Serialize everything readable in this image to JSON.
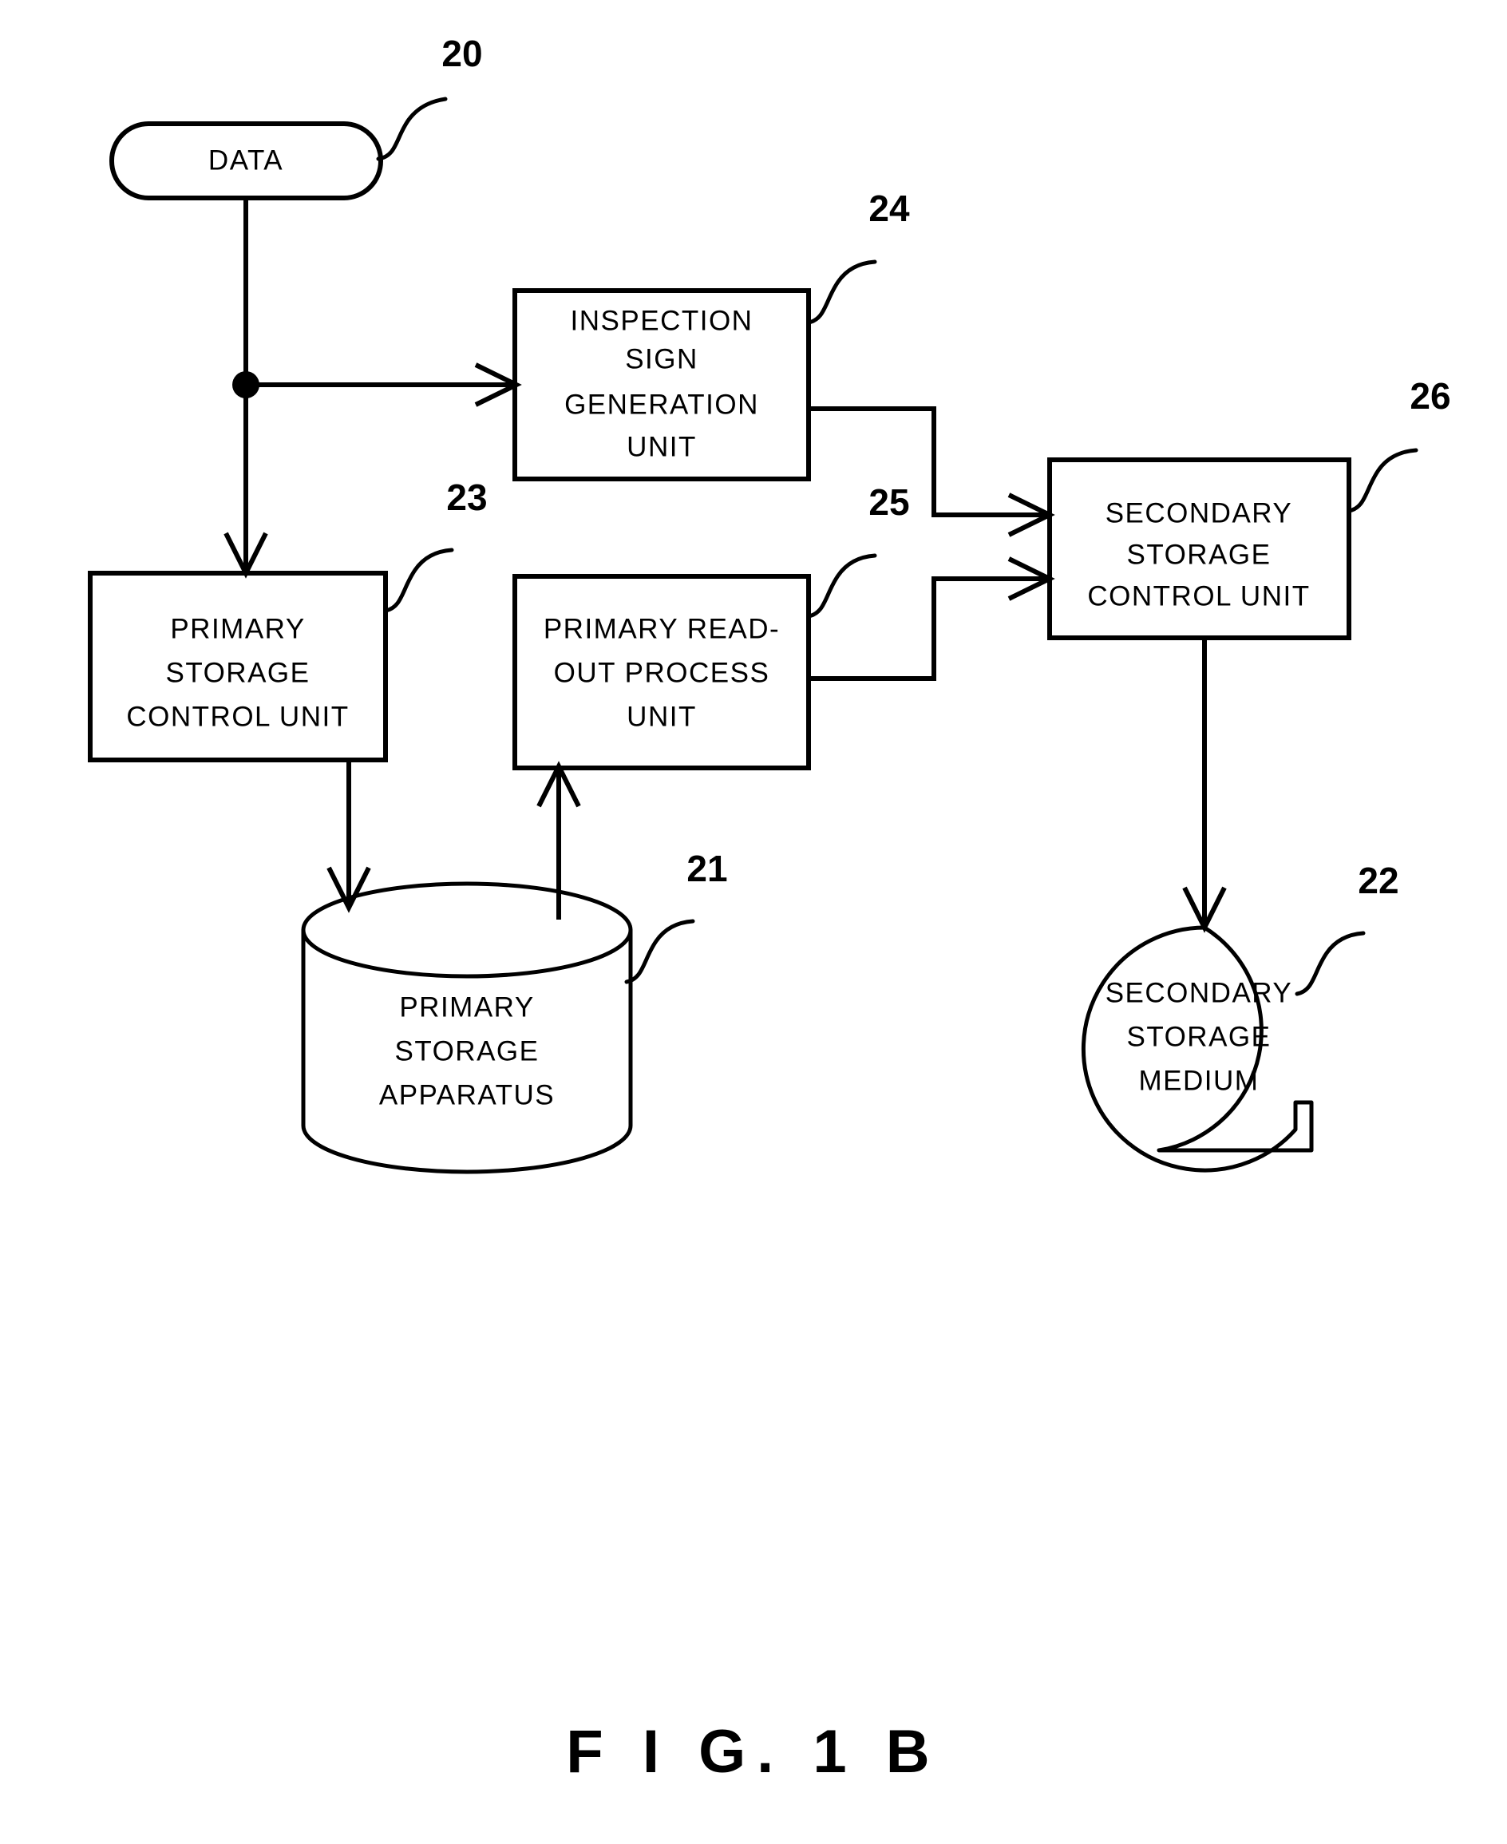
{
  "figure": {
    "caption": "F I G.  1 B",
    "background_color": "#ffffff",
    "line_color": "#000000"
  },
  "nodes": [
    {
      "id": "data",
      "shape": "rounded-pill",
      "ref": "20",
      "lines": [
        "DATA"
      ]
    },
    {
      "id": "inspection-sign-generation-unit",
      "shape": "rectangle",
      "ref": "24",
      "lines": [
        "INSPECTION",
        "SIGN",
        "GENERATION",
        "UNIT"
      ]
    },
    {
      "id": "primary-storage-control-unit",
      "shape": "rectangle",
      "ref": "23",
      "lines": [
        "PRIMARY",
        "STORAGE",
        "CONTROL UNIT"
      ]
    },
    {
      "id": "primary-read-out-process-unit",
      "shape": "rectangle",
      "ref": "25",
      "lines": [
        "PRIMARY READ-",
        "OUT PROCESS",
        "UNIT"
      ]
    },
    {
      "id": "secondary-storage-control-unit",
      "shape": "rectangle",
      "ref": "26",
      "lines": [
        "SECONDARY",
        "STORAGE",
        "CONTROL UNIT"
      ]
    },
    {
      "id": "primary-storage-apparatus",
      "shape": "cylinder",
      "ref": "21",
      "lines": [
        "PRIMARY",
        "STORAGE",
        "APPARATUS"
      ]
    },
    {
      "id": "secondary-storage-medium",
      "shape": "disc-notched-circle",
      "ref": "22",
      "lines": [
        "SECONDARY",
        "STORAGE",
        "MEDIUM"
      ]
    }
  ],
  "reference_numbers": {
    "data": "20",
    "primary_storage_apparatus": "21",
    "secondary_storage_medium": "22",
    "primary_storage_control_unit": "23",
    "inspection_sign_generation_unit": "24",
    "primary_read_out_process_unit": "25",
    "secondary_storage_control_unit": "26"
  },
  "node_text": {
    "data_l1": "DATA",
    "inspection_l1": "INSPECTION",
    "inspection_l2": "SIGN",
    "inspection_l3": "GENERATION",
    "inspection_l4": "UNIT",
    "primary_ctrl_l1": "PRIMARY",
    "primary_ctrl_l2": "STORAGE",
    "primary_ctrl_l3": "CONTROL UNIT",
    "readout_l1": "PRIMARY READ-",
    "readout_l2": "OUT PROCESS",
    "readout_l3": "UNIT",
    "secondary_ctrl_l1": "SECONDARY",
    "secondary_ctrl_l2": "STORAGE",
    "secondary_ctrl_l3": "CONTROL UNIT",
    "primary_apparatus_l1": "PRIMARY",
    "primary_apparatus_l2": "STORAGE",
    "primary_apparatus_l3": "APPARATUS",
    "secondary_medium_l1": "SECONDARY",
    "secondary_medium_l2": "STORAGE",
    "secondary_medium_l3": "MEDIUM"
  },
  "connections": [
    {
      "id": "data-to-junction",
      "from": "data",
      "to": "junction",
      "arrow": false
    },
    {
      "id": "junction-to-primary-storage-control-unit",
      "from": "junction",
      "to": "primary-storage-control-unit",
      "arrow": true
    },
    {
      "id": "junction-to-inspection-sign-generation-unit",
      "from": "junction",
      "to": "inspection-sign-generation-unit",
      "arrow": true
    },
    {
      "id": "inspection-to-secondary-storage-control-unit",
      "from": "inspection-sign-generation-unit",
      "to": "secondary-storage-control-unit",
      "arrow": true
    },
    {
      "id": "readout-to-secondary-storage-control-unit",
      "from": "primary-read-out-process-unit",
      "to": "secondary-storage-control-unit",
      "arrow": true
    },
    {
      "id": "primary-storage-control-unit-to-apparatus",
      "from": "primary-storage-control-unit",
      "to": "primary-storage-apparatus",
      "arrow": true
    },
    {
      "id": "apparatus-to-primary-read-out-process-unit",
      "from": "primary-storage-apparatus",
      "to": "primary-read-out-process-unit",
      "arrow": true
    },
    {
      "id": "secondary-storage-control-unit-to-medium",
      "from": "secondary-storage-control-unit",
      "to": "secondary-storage-medium",
      "arrow": true
    }
  ]
}
